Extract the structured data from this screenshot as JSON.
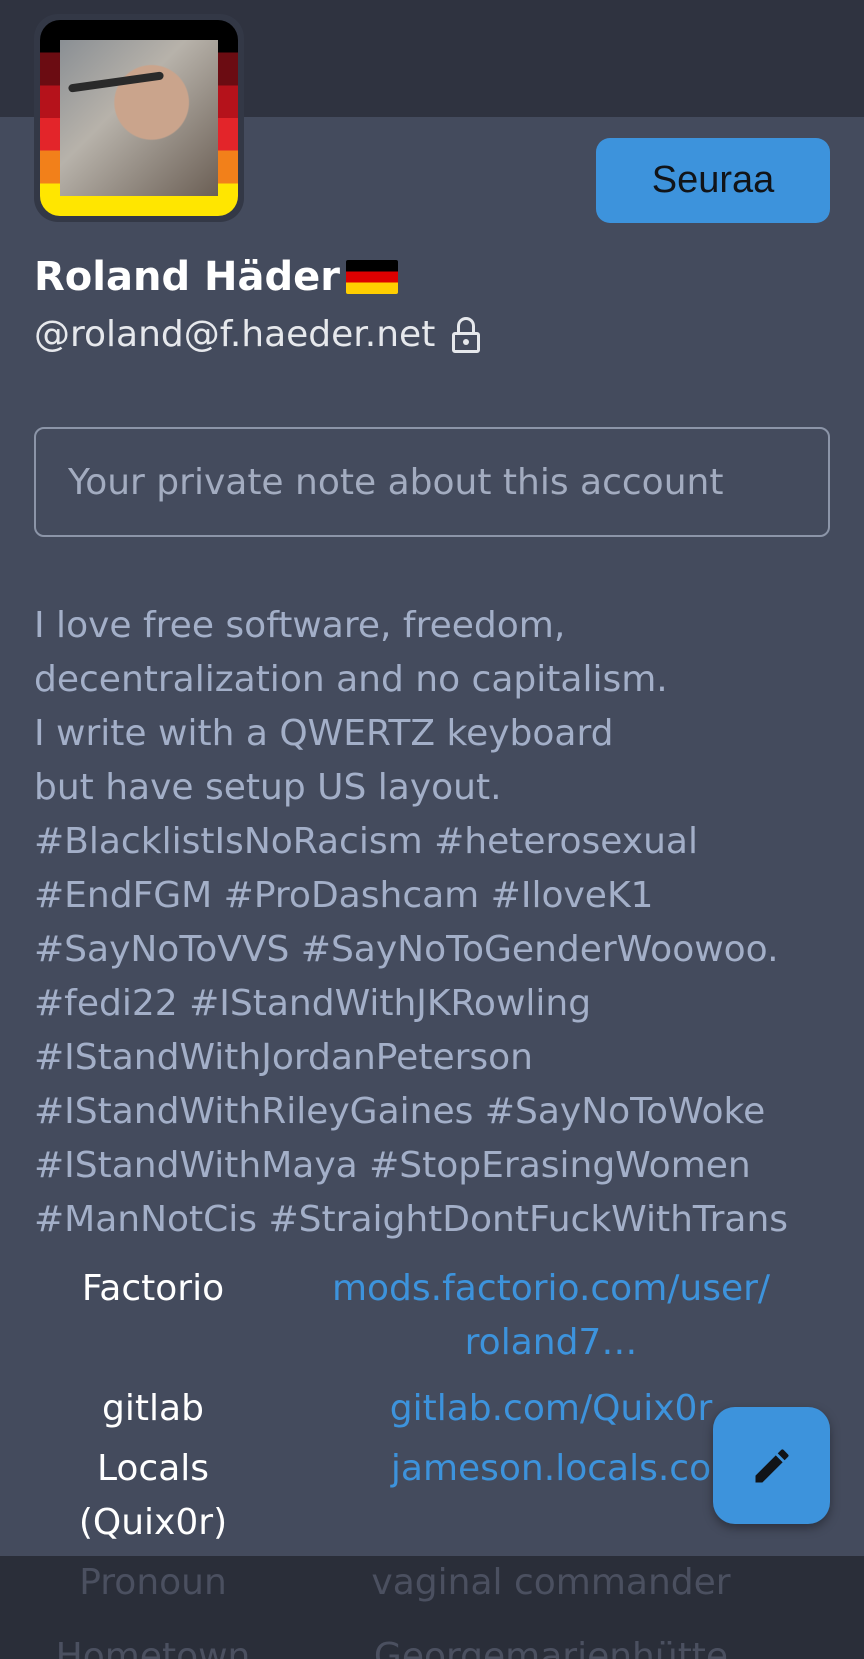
{
  "profile": {
    "display_name": "Roland Häder",
    "handle": "@roland@f.haeder.net",
    "follow_label": "Seuraa",
    "note_placeholder": "Your private note about this account"
  },
  "bio_lines": [
    "I love free software, freedom,",
    "decentralization and no capitalism.",
    "I write with a QWERTZ keyboard",
    "but have setup US layout.",
    "#BlacklistIsNoRacism #heterosexual",
    "#EndFGM #ProDashcam #IloveK1",
    "#SayNoToVVS #SayNoToGenderWoowoo.",
    "#fedi22 #IStandWithJKRowling",
    "#IStandWithJordanPeterson",
    "#IStandWithRileyGaines #SayNoToWoke",
    "#IStandWithMaya #StopErasingWomen",
    "#ManNotCis #StraightDontFuckWithTrans"
  ],
  "fields": [
    {
      "name": "Factorio",
      "value_lines": [
        "mods.factorio.com/user/",
        "roland7…"
      ]
    },
    {
      "name": "gitlab",
      "value_lines": [
        "gitlab.com/Quix0r"
      ]
    },
    {
      "name_lines": [
        "Locals",
        "(Quix0r)"
      ],
      "value_lines": [
        "jameson.locals.co"
      ]
    }
  ],
  "bottom_fields": [
    {
      "name": "Pronoun",
      "value": "vaginal commander"
    },
    {
      "name": "Hometown",
      "value": "Georgemarienhütte"
    }
  ],
  "icons": {
    "lock": "lock-icon",
    "edit": "pencil-icon",
    "flag": "german-flag"
  },
  "colors": {
    "accent": "#3d93dc",
    "background": "#444b5d",
    "header": "#2f3340",
    "bio_text": "#a3afc8"
  }
}
